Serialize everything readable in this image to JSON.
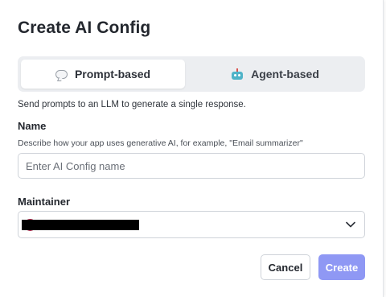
{
  "dialog": {
    "title": "Create AI Config"
  },
  "mode_toggle": {
    "options": [
      {
        "label": "Prompt-based",
        "icon": "speech-bubble-icon",
        "selected": true
      },
      {
        "label": "Agent-based",
        "icon": "robot-icon",
        "selected": false
      }
    ],
    "description": "Send prompts to an LLM to generate a single response."
  },
  "name_field": {
    "label": "Name",
    "hint": "Describe how your app uses generative AI, for example, \"Email summarizer\"",
    "placeholder": "Enter AI Config name",
    "value": ""
  },
  "maintainer_field": {
    "label": "Maintainer",
    "value_redacted": true,
    "avatar_color": "#b0264a"
  },
  "actions": {
    "cancel_label": "Cancel",
    "create_label": "Create",
    "create_color": "#8f98f4"
  }
}
